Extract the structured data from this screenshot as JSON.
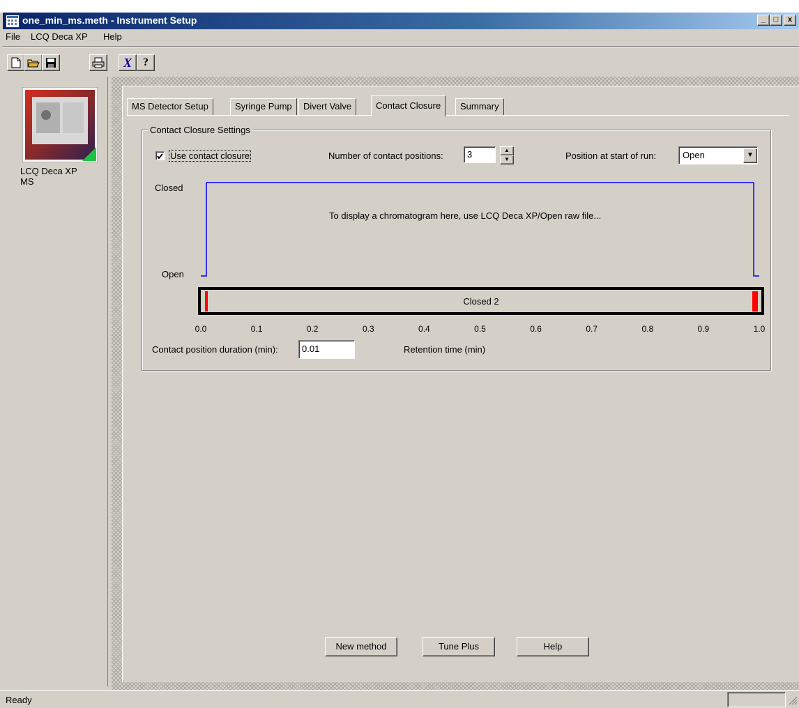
{
  "window": {
    "title": "one_min_ms.meth - Instrument Setup",
    "minimize": "_",
    "maximize": "□",
    "close": "x"
  },
  "menu": [
    "File",
    "LCQ Deca XP",
    "Help"
  ],
  "toolbar": {
    "icons": [
      "new-file-icon",
      "open-folder-icon",
      "save-icon",
      "print-icon",
      "cut-icon",
      "help-pointer-icon"
    ]
  },
  "device": {
    "label": "LCQ Deca XP MS"
  },
  "tabs": [
    {
      "label": "MS Detector Setup",
      "active": false
    },
    {
      "label": "Syringe Pump",
      "active": false
    },
    {
      "label": "Divert Valve",
      "active": false
    },
    {
      "label": "Contact Closure",
      "active": true
    },
    {
      "label": "Summary",
      "active": false
    }
  ],
  "settings": {
    "group_title": "Contact Closure Settings",
    "use_contact_closure": {
      "label": "Use contact closure",
      "checked": true
    },
    "num_positions_label": "Number of contact positions:",
    "num_positions_value": "3",
    "start_position_label": "Position at start of run:",
    "start_position_value": "Open"
  },
  "plot": {
    "label_closed": "Closed",
    "label_open": "Open",
    "message": "To display a chromatogram here, use LCQ Deca XP/Open raw file...",
    "timeline_label": "Closed 2",
    "line_color": "#0000ff",
    "marker_color": "#ff0000"
  },
  "chart_data": {
    "type": "line",
    "xlabel": "Retention time (min)",
    "ylabel": "",
    "xlim": [
      0.0,
      1.0
    ],
    "x_ticks": [
      "0.0",
      "0.1",
      "0.2",
      "0.3",
      "0.4",
      "0.5",
      "0.6",
      "0.7",
      "0.8",
      "0.9",
      "1.0"
    ],
    "y_levels": [
      "Open",
      "Closed"
    ],
    "series": [
      {
        "x": [
          0.0,
          0.01,
          0.01,
          0.99,
          0.99,
          1.0
        ],
        "y": [
          "Open",
          "Open",
          "Closed",
          "Closed",
          "Open",
          "Open"
        ]
      }
    ],
    "markers": [
      0.01,
      0.99,
      0.995
    ]
  },
  "duration": {
    "label": "Contact position duration (min):",
    "value": "0.01"
  },
  "buttons": {
    "new_method": "New method",
    "tune_plus": "Tune Plus",
    "help": "Help"
  },
  "status": "Ready"
}
